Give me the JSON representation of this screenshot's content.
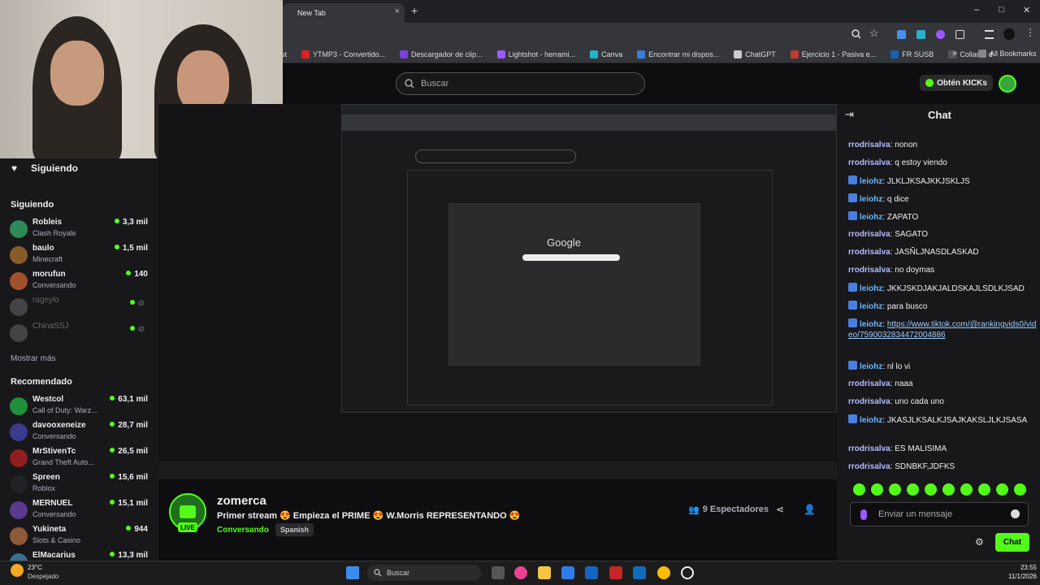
{
  "browser": {
    "tab_title": "New Tab",
    "new_tab_symbol": "+",
    "close_symbol": "×",
    "window_controls": [
      "–",
      "□",
      "✕"
    ],
    "bookmarks": [
      {
        "label": "st",
        "color": "#444"
      },
      {
        "label": "YTMP3 - Convertido...",
        "color": "#e02020"
      },
      {
        "label": "Descargador de clip...",
        "color": "#7a3fe0"
      },
      {
        "label": "Lightshot - herrami...",
        "color": "#9b59ff"
      },
      {
        "label": "Canva",
        "color": "#22b5c9"
      },
      {
        "label": "Encontrar mi dispos...",
        "color": "#3b7ddd"
      },
      {
        "label": "ChatGPT",
        "color": "#cccccc"
      },
      {
        "label": "Ejercicio 1 - Pasiva e...",
        "color": "#c0392b"
      },
      {
        "label": "FR SUSB",
        "color": "#1a5fb4"
      },
      {
        "label": "Collares d",
        "color": "#555"
      }
    ],
    "all_bookmarks": "All Bookmarks"
  },
  "header": {
    "search_placeholder": "Buscar",
    "kicks_label": "Obtén KICKs"
  },
  "sidebar": {
    "section_title": "Siguiendo",
    "following_label": "Siguiendo",
    "following": [
      {
        "name": "Robleis",
        "sub": "Clash Royale",
        "viewers": "3,3 mil",
        "color": "#2e8b57"
      },
      {
        "name": "baulo",
        "sub": "Minecraft",
        "viewers": "1,5 mil",
        "color": "#8b5a2b"
      },
      {
        "name": "morufun",
        "sub": "Conversando",
        "viewers": "140",
        "color": "#a0522d"
      },
      {
        "name": "rageylo",
        "sub": "",
        "viewers": "",
        "color": "#444"
      },
      {
        "name": "ChinaSSJ",
        "sub": "",
        "viewers": "",
        "color": "#444"
      }
    ],
    "show_more": "Mostrar más",
    "recommended_label": "Recomendado",
    "recommended": [
      {
        "name": "Westcol",
        "sub": "Call of Duty: Warz...",
        "viewers": "63,1 mil",
        "color": "#1f8f3a"
      },
      {
        "name": "davooxeneize",
        "sub": "Conversando",
        "viewers": "28,7 mil",
        "color": "#3a3a8f"
      },
      {
        "name": "MrStivenTc",
        "sub": "Grand Theft Auto...",
        "viewers": "26,5 mil",
        "color": "#8f1f1f"
      },
      {
        "name": "Spreen",
        "sub": "Roblox",
        "viewers": "15,6 mil",
        "color": "#222222"
      },
      {
        "name": "MERNUEL",
        "sub": "Conversando",
        "viewers": "15,1 mil",
        "color": "#5a3a8f"
      },
      {
        "name": "Yukineta",
        "sub": "Slots & Casino",
        "viewers": "944",
        "color": "#8f5a3a"
      },
      {
        "name": "ElMacarius",
        "sub": "",
        "viewers": "13,3 mil",
        "color": "#3a6f8f"
      }
    ]
  },
  "stream": {
    "channel": "zomerca",
    "title": "Primer stream 😍 Empieza el PRIME 😍 W.Morris REPRESENTANDO 😍",
    "category": "Conversando",
    "language": "Spanish",
    "live_badge": "LIVE",
    "viewers": "9 Espectadores"
  },
  "chat": {
    "title": "Chat",
    "messages": [
      {
        "user": "rrodrisalva",
        "badge": false,
        "text": "nonon"
      },
      {
        "user": "rrodrisalva",
        "badge": false,
        "text": "q estoy viendo"
      },
      {
        "user": "leiohz",
        "badge": true,
        "text": "JLKLJKSAJKKJSKLJS"
      },
      {
        "user": "leiohz",
        "badge": true,
        "text": "q dice"
      },
      {
        "user": "leiohz",
        "badge": true,
        "text": "ZAPATO"
      },
      {
        "user": "rrodrisalva",
        "badge": false,
        "text": "SAGATO"
      },
      {
        "user": "rrodrisalva",
        "badge": false,
        "text": "JASÑLJNASDLASKAD"
      },
      {
        "user": "rrodrisalva",
        "badge": false,
        "text": "no doymas"
      },
      {
        "user": "leiohz",
        "badge": true,
        "text": "JKKJSKDJAKJALDSKAJLSDLKJSAD"
      },
      {
        "user": "leiohz",
        "badge": true,
        "text": "para busco"
      },
      {
        "user": "leiohz",
        "badge": true,
        "text": "https://www.tiktok.com/@rankingvids0/video/7590032834472004886"
      },
      {
        "user": "leiohz",
        "badge": true,
        "text": "nl lo vi"
      },
      {
        "user": "rrodrisalva",
        "badge": false,
        "text": "naaa"
      },
      {
        "user": "rrodrisalva",
        "badge": false,
        "text": "uno cada uno"
      },
      {
        "user": "leiohz",
        "badge": true,
        "text": "JKASJLKSALKJSAJKAKSLJLKJSASA"
      },
      {
        "user": "rrodrisalva",
        "badge": false,
        "text": "ES MALISIMA"
      },
      {
        "user": "rrodrisalva",
        "badge": false,
        "text": "SDNBKF,JDFKS"
      }
    ],
    "input_placeholder": "Enviar un mensaje",
    "send_label": "Chat"
  },
  "taskbar": {
    "weather_temp": "23°C",
    "weather_text": "Despejado",
    "search_label": "Buscar",
    "time": "23:55",
    "date": "11/1/2026"
  }
}
